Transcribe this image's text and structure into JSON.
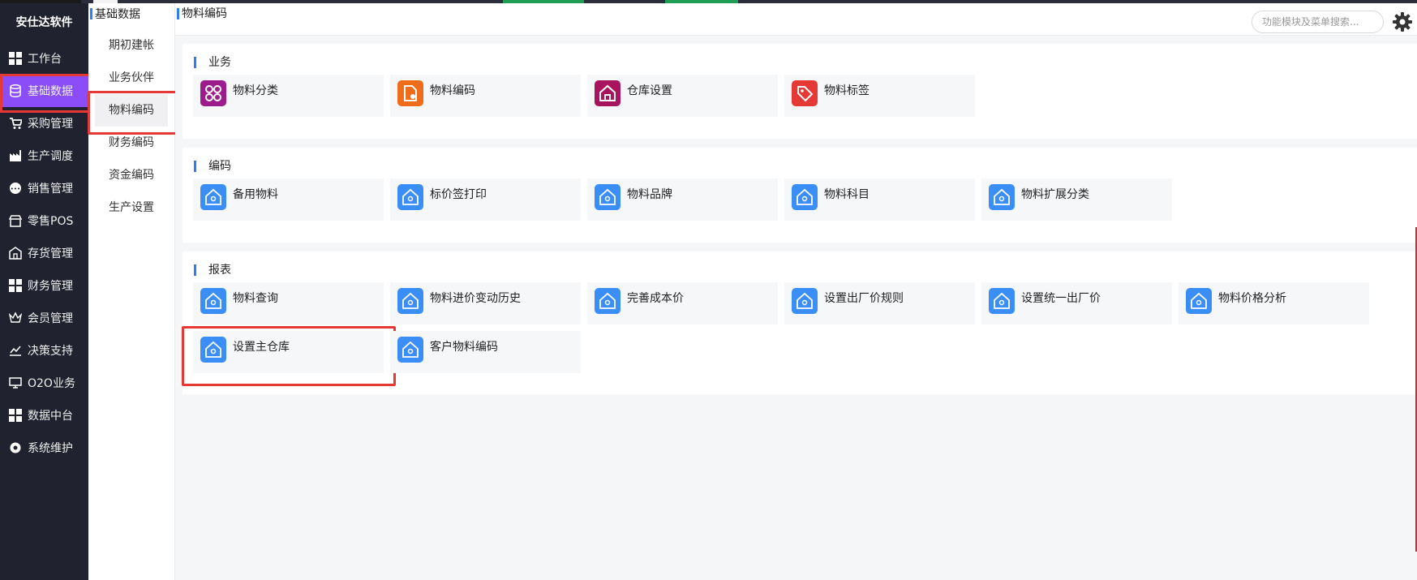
{
  "sidebar": {
    "brand": "安仕达软件",
    "items": [
      {
        "label": "工作台",
        "icon": "grid-icon"
      },
      {
        "label": "基础数据",
        "icon": "database-icon"
      },
      {
        "label": "采购管理",
        "icon": "cart-icon"
      },
      {
        "label": "生产调度",
        "icon": "factory-icon"
      },
      {
        "label": "销售管理",
        "icon": "sale-icon"
      },
      {
        "label": "零售POS",
        "icon": "store-icon"
      },
      {
        "label": "存货管理",
        "icon": "warehouse-icon"
      },
      {
        "label": "财务管理",
        "icon": "grid-icon"
      },
      {
        "label": "会员管理",
        "icon": "crown-icon"
      },
      {
        "label": "决策支持",
        "icon": "chart-icon"
      },
      {
        "label": "O2O业务",
        "icon": "monitor-icon"
      },
      {
        "label": "数据中台",
        "icon": "grid-icon"
      },
      {
        "label": "系统维护",
        "icon": "gear-icon"
      }
    ],
    "active_index": 1
  },
  "subbar": {
    "title": "基础数据",
    "items": [
      "期初建帐",
      "业务伙伴",
      "物料编码",
      "财务编码",
      "资金编码",
      "生产设置"
    ],
    "active_index": 2
  },
  "header": {
    "breadcrumb": "物料编码",
    "search_placeholder": "功能模块及菜单搜索..."
  },
  "sections": [
    {
      "title": "业务",
      "tiles": [
        {
          "label": "物料分类",
          "icon": "apps-icon",
          "color": "#9c1c8e"
        },
        {
          "label": "物料编码",
          "icon": "file-gear-icon",
          "color": "#ef6c1a"
        },
        {
          "label": "仓库设置",
          "icon": "home-icon",
          "color": "#a8145e"
        },
        {
          "label": "物料标签",
          "icon": "tag-icon",
          "color": "#e53935"
        }
      ]
    },
    {
      "title": "编码",
      "tiles": [
        {
          "label": "备用物料",
          "icon": "house-search-icon",
          "color": "#3a8ef6"
        },
        {
          "label": "标价签打印",
          "icon": "house-search-icon",
          "color": "#3a8ef6"
        },
        {
          "label": "物料品牌",
          "icon": "house-search-icon",
          "color": "#3a8ef6"
        },
        {
          "label": "物料科目",
          "icon": "house-search-icon",
          "color": "#3a8ef6"
        },
        {
          "label": "物料扩展分类",
          "icon": "house-search-icon",
          "color": "#3a8ef6"
        }
      ]
    },
    {
      "title": "报表",
      "tiles": [
        {
          "label": "物料查询",
          "icon": "house-search-icon",
          "color": "#3a8ef6"
        },
        {
          "label": "物料进价变动历史",
          "icon": "house-search-icon",
          "color": "#3a8ef6"
        },
        {
          "label": "完善成本价",
          "icon": "house-search-icon",
          "color": "#3a8ef6"
        },
        {
          "label": "设置出厂价规则",
          "icon": "house-search-icon",
          "color": "#3a8ef6"
        },
        {
          "label": "设置统一出厂价",
          "icon": "house-search-icon",
          "color": "#3a8ef6"
        },
        {
          "label": "物料价格分析",
          "icon": "house-search-icon",
          "color": "#3a8ef6"
        },
        {
          "label": "设置主仓库",
          "icon": "house-search-icon",
          "color": "#3a8ef6"
        },
        {
          "label": "客户物料编码",
          "icon": "house-search-icon",
          "color": "#3a8ef6"
        }
      ]
    }
  ],
  "colors": {
    "sidebar_bg": "#20222f",
    "active_nav": "#8a4df7",
    "accent_blue": "#2f80ed",
    "highlight_red": "#e53935"
  }
}
